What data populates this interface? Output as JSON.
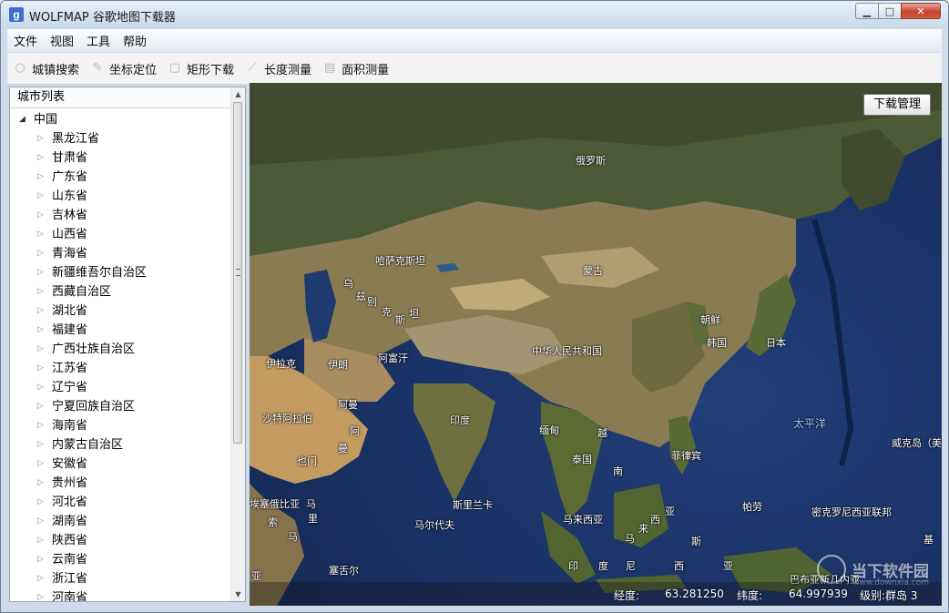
{
  "window": {
    "title": "WOLFMAP 谷歌地图下载器",
    "icon": "g-icon"
  },
  "menu": [
    "文件",
    "视图",
    "工具",
    "帮助"
  ],
  "toolbar": [
    {
      "label": "城镇搜索",
      "icon": "search-icon"
    },
    {
      "label": "坐标定位",
      "icon": "pin-icon"
    },
    {
      "label": "矩形下载",
      "icon": "rectangle-icon"
    },
    {
      "label": "长度测量",
      "icon": "ruler-icon"
    },
    {
      "label": "面积测量",
      "icon": "area-icon"
    }
  ],
  "city_panel": {
    "header": "城市列表",
    "root": "中国",
    "provinces": [
      "黑龙江省",
      "甘肃省",
      "广东省",
      "山东省",
      "吉林省",
      "山西省",
      "青海省",
      "新疆维吾尔自治区",
      "西藏自治区",
      "湖北省",
      "福建省",
      "广西壮族自治区",
      "江苏省",
      "辽宁省",
      "宁夏回族自治区",
      "海南省",
      "内蒙古自治区",
      "安徽省",
      "贵州省",
      "河北省",
      "湖南省",
      "陕西省",
      "云南省",
      "浙江省",
      "河南省"
    ]
  },
  "map": {
    "download_manager_label": "下载管理",
    "labels": [
      "俄罗斯",
      "哈萨克斯坦",
      "蒙古",
      "乌",
      "兹",
      "别",
      "克",
      "斯",
      "坦",
      "朝鲜",
      "韩国",
      "日本",
      "伊拉克",
      "伊朗",
      "阿富汗",
      "中华人民共和国",
      "沙特阿拉伯",
      "阿曼",
      "阿",
      "曼",
      "印度",
      "缅甸",
      "越",
      "泰国",
      "菲律宾",
      "南",
      "也门",
      "太平洋",
      "威克岛（美）",
      "埃塞俄比亚",
      "斯里兰卡",
      "马尔代夫",
      "马来西亚",
      "马",
      "来",
      "西",
      "亚",
      "帕劳",
      "密克罗尼西亚联邦",
      "塞舌尔",
      "印",
      "度",
      "尼",
      "西",
      "亚",
      "巴布亚新几内亚",
      "索",
      "马",
      "里",
      "马",
      "亚",
      "斯",
      "基"
    ],
    "status": {
      "lon_label": "经度:",
      "lon_value": "63.281250",
      "lat_label": "纬度:",
      "lat_value": "64.997939",
      "level_text": "级别:群岛 3"
    },
    "watermark": {
      "text": "当下软件园",
      "sub": "www.downxia.com"
    }
  },
  "colors": {
    "accent": "#3b6fd4",
    "ocean": "#1d3668",
    "land": "#6e7a4a",
    "desert": "#b89a68"
  }
}
